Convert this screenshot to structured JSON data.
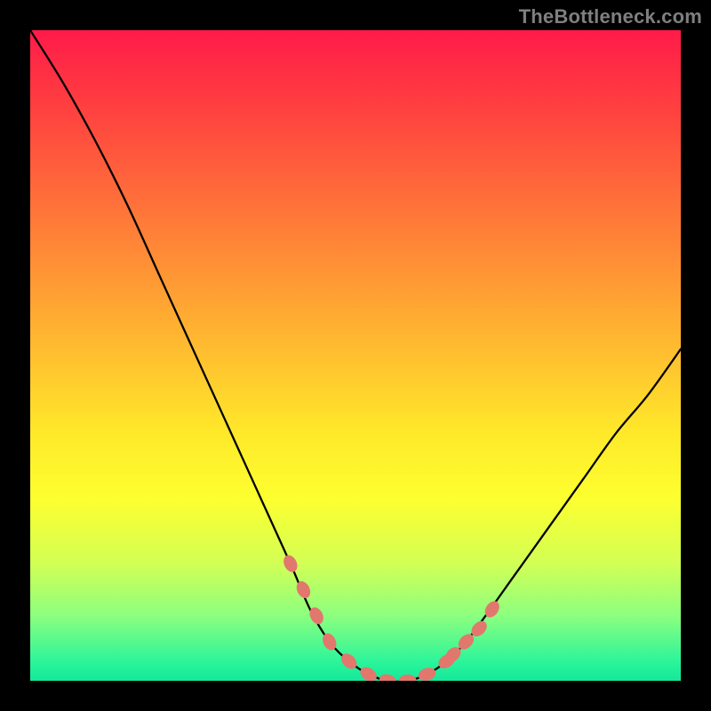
{
  "watermark": "TheBottleneck.com",
  "colors": {
    "frame": "#000000",
    "curve": "#000000",
    "marker": "#e2776d",
    "watermark": "#7f7f7f",
    "gradient_stops": [
      "#ff1b49",
      "#ff4040",
      "#ff7c38",
      "#ffb930",
      "#ffe92a",
      "#fdff2f",
      "#d2ff55",
      "#8cff7f",
      "#2cf59a",
      "#14e89b"
    ]
  },
  "chart_data": {
    "type": "line",
    "title": "",
    "xlabel": "",
    "ylabel": "",
    "xlim": [
      0,
      100
    ],
    "ylim": [
      0,
      100
    ],
    "x": [
      0,
      5,
      10,
      15,
      20,
      25,
      30,
      35,
      40,
      43,
      46,
      49,
      52,
      55,
      58,
      61,
      64,
      67,
      70,
      75,
      80,
      85,
      90,
      95,
      100
    ],
    "y": [
      100,
      92,
      83,
      73,
      62,
      51,
      40,
      29,
      18,
      11,
      6,
      3,
      1,
      0,
      0,
      1,
      3,
      6,
      10,
      17,
      24,
      31,
      38,
      44,
      51
    ],
    "markers": {
      "x": [
        40,
        42,
        44,
        46,
        49,
        52,
        55,
        58,
        61,
        64,
        65,
        67,
        69,
        71
      ],
      "y": [
        18,
        14,
        10,
        6,
        3,
        1,
        0,
        0,
        1,
        3,
        4,
        6,
        8,
        11
      ]
    }
  }
}
